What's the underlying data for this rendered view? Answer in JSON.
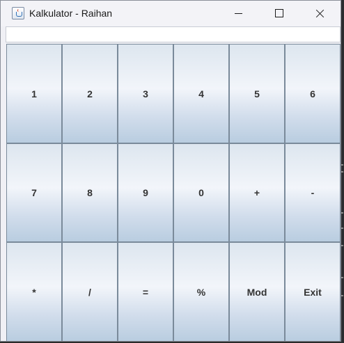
{
  "window": {
    "title": "Kalkulator - Raihan",
    "controls": {
      "minimize_icon": "minimize-icon",
      "maximize_icon": "maximize-icon",
      "close_icon": "close-icon"
    }
  },
  "display": {
    "value": ""
  },
  "buttons": [
    [
      "1",
      "2",
      "3",
      "4",
      "5",
      "6"
    ],
    [
      "7",
      "8",
      "9",
      "0",
      "+",
      "-"
    ],
    [
      "*",
      "/",
      "=",
      "%",
      "Mod",
      "Exit"
    ]
  ],
  "colors": {
    "button_top": "#dde6ef",
    "button_highlight": "#f2f5fa",
    "button_bottom": "#b9cde0",
    "button_border": "#7a8a9a",
    "button_text": "#333333"
  }
}
